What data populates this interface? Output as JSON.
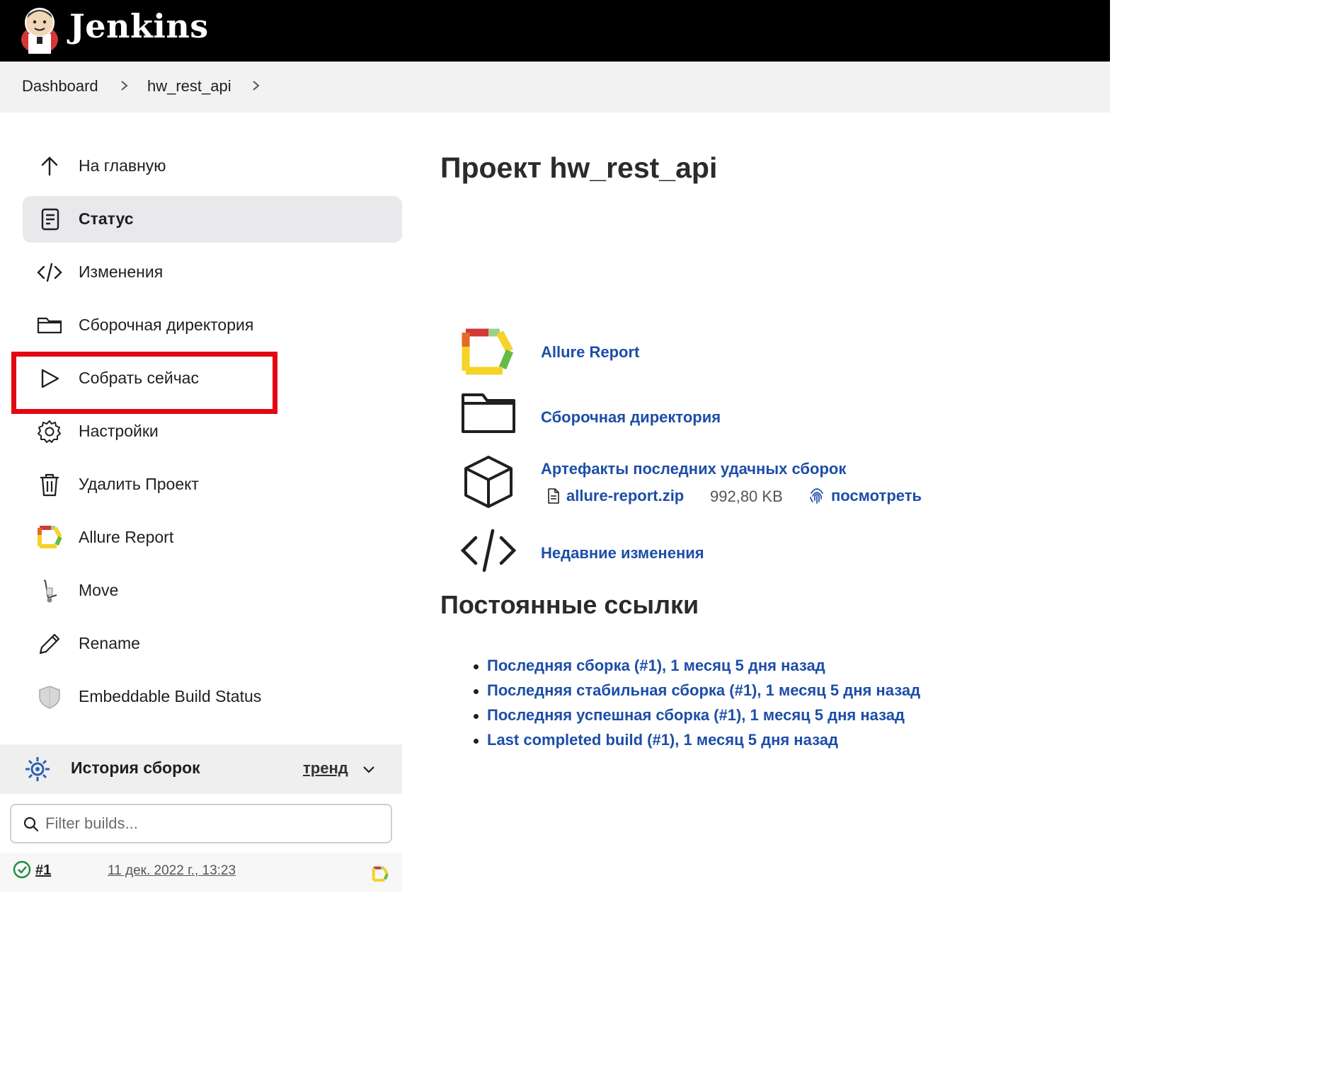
{
  "header": {
    "app_name": "Jenkins",
    "logo": "jenkins-butler-logo"
  },
  "breadcrumb": {
    "items": [
      "Dashboard",
      "hw_rest_api"
    ]
  },
  "sidebar": {
    "items": [
      {
        "label": "На главную",
        "icon": "arrow-up-icon"
      },
      {
        "label": "Статус",
        "icon": "document-icon",
        "active": true
      },
      {
        "label": "Изменения",
        "icon": "code-icon"
      },
      {
        "label": "Сборочная директория",
        "icon": "folder-icon"
      },
      {
        "label": "Собрать сейчас",
        "icon": "play-icon",
        "highlighted": true
      },
      {
        "label": "Настройки",
        "icon": "gear-icon"
      },
      {
        "label": "Удалить Проект",
        "icon": "trash-icon"
      },
      {
        "label": "Allure Report",
        "icon": "allure-icon"
      },
      {
        "label": "Move",
        "icon": "hand-truck-icon"
      },
      {
        "label": "Rename",
        "icon": "pencil-icon"
      },
      {
        "label": "Embeddable Build Status",
        "icon": "shield-icon"
      }
    ],
    "highlight_color": "#e30613"
  },
  "build_history": {
    "title": "История сборок",
    "trend_label": "тренд",
    "filter_placeholder": "Filter builds...",
    "builds": [
      {
        "number": "#1",
        "date": "11 дек. 2022 г., 13:23",
        "status": "success"
      }
    ]
  },
  "main": {
    "title": "Проект hw_rest_api",
    "links": {
      "allure": "Allure Report",
      "workspace": "Сборочная директория",
      "artifacts": "Артефакты последних удачных сборок",
      "changes": "Недавние изменения"
    },
    "artifact": {
      "file_name": "allure-report.zip",
      "size": "992,80 KB",
      "view_label": "посмотреть"
    },
    "permalinks_title": "Постоянные ссылки",
    "permalinks": [
      "Последняя сборка (#1), 1 месяц 5 дня назад",
      "Последняя стабильная сборка (#1), 1 месяц 5 дня назад",
      "Последняя успешная сборка (#1), 1 месяц 5 дня назад",
      "Last completed build (#1), 1 месяц 5 дня назад"
    ]
  },
  "colors": {
    "link": "#1d4ea8",
    "header_bg": "#000000",
    "active_bg": "#e9e9eb"
  }
}
